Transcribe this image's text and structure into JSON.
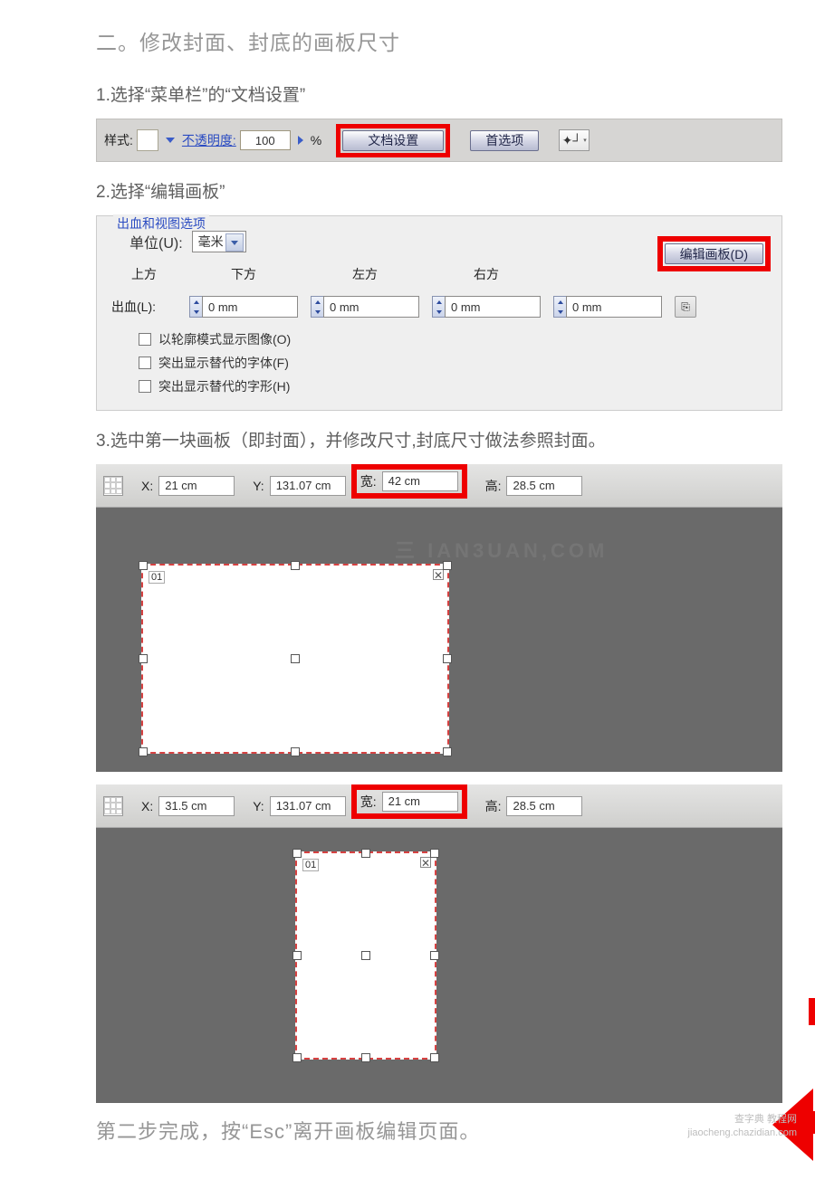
{
  "headings": {
    "h2": "二。修改封面、封底的画板尺寸",
    "step1": "1.选择“菜单栏”的“文档设置”",
    "step2": "2.选择“编辑画板”",
    "step3": "3.选中第一块画板（即封面），并修改尺寸,封底尺寸做法参照封面。",
    "final": "第二步完成，按“Esc”离开画板编辑页面。"
  },
  "toolbar": {
    "style_label": "样式:",
    "opacity_label": "不透明度:",
    "opacity_value": "100",
    "percent": "%",
    "doc_setup_btn": "文档设置",
    "prefs_btn": "首选项"
  },
  "panel": {
    "legend": "出血和视图选项",
    "unit_label": "单位(U):",
    "unit_value": "毫米",
    "edit_artboard_btn": "编辑画板(D)",
    "heads": {
      "top": "上方",
      "bottom": "下方",
      "left": "左方",
      "right": "右方"
    },
    "bleed_label": "出血(L):",
    "bleed_values": {
      "top": "0 mm",
      "bottom": "0 mm",
      "left": "0 mm",
      "right": "0 mm"
    },
    "checks": {
      "outline": "以轮廓模式显示图像(O)",
      "subfont": "突出显示替代的字体(F)",
      "subglyph": "突出显示替代的字形(H)"
    }
  },
  "ws1": {
    "x_label": "X:",
    "x_value": "21 cm",
    "y_label": "Y:",
    "y_value": "131.07 cm",
    "w_label": "宽:",
    "w_value": "42 cm",
    "h_label": "高:",
    "h_value": "28.5 cm",
    "artboard_number": "01"
  },
  "ws2": {
    "x_label": "X:",
    "x_value": "31.5 cm",
    "y_label": "Y:",
    "y_value": "131.07 cm",
    "w_label": "宽:",
    "w_value": "21 cm",
    "h_label": "高:",
    "h_value": "28.5 cm",
    "artboard_number": "01"
  },
  "footer": {
    "line1": "查字典 教程网",
    "line2": "jiaocheng.chazidian.com"
  },
  "colors": {
    "highlight": "#ee0000"
  }
}
